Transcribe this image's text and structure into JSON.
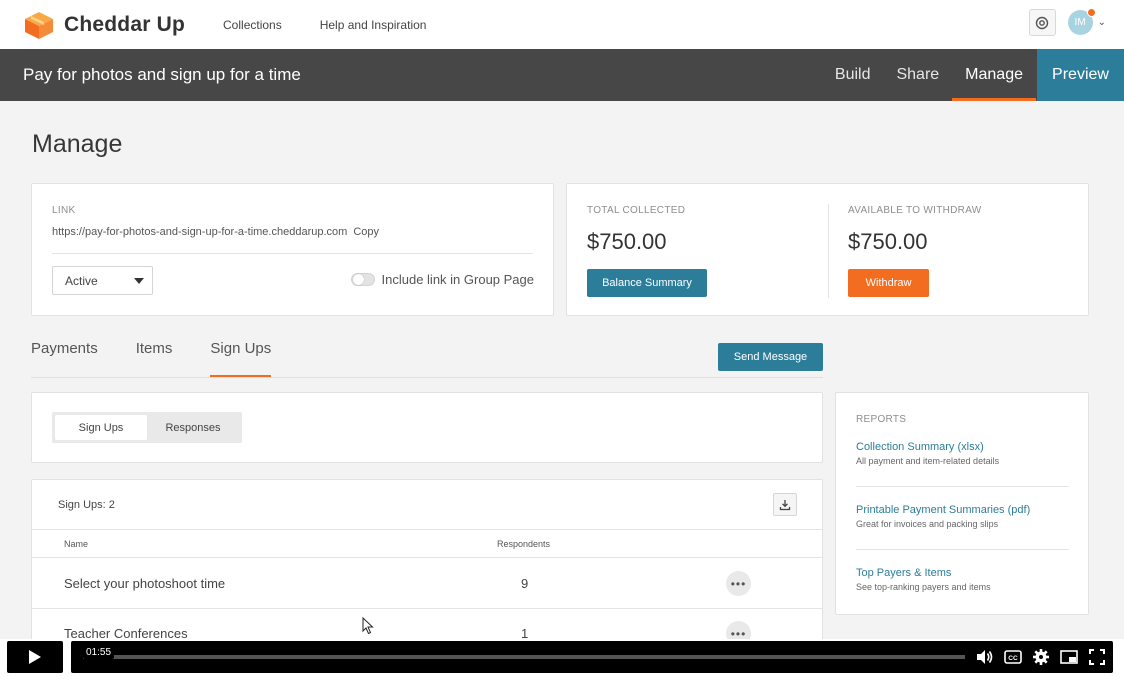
{
  "brand": {
    "name": "Cheddar Up",
    "accent": "#f36d21",
    "primary": "#2c7d99"
  },
  "topnav": {
    "links": [
      "Collections",
      "Help and Inspiration"
    ],
    "avatar_initials": "IM"
  },
  "header": {
    "title": "Pay for photos and sign up for a time",
    "tabs": [
      "Build",
      "Share",
      "Manage",
      "Preview"
    ],
    "active_tab": "Manage"
  },
  "page": {
    "title": "Manage"
  },
  "link_card": {
    "label": "LINK",
    "url": "https://pay-for-photos-and-sign-up-for-a-time.cheddarup.com",
    "copy_label": "Copy",
    "status_value": "Active",
    "toggle_label": "Include link in Group Page"
  },
  "money": {
    "total_label": "TOTAL COLLECTED",
    "total_amount": "$750.00",
    "balance_button": "Balance Summary",
    "available_label": "AVAILABLE TO WITHDRAW",
    "available_amount": "$750.00",
    "withdraw_button": "Withdraw"
  },
  "tabs": {
    "items": [
      "Payments",
      "Items",
      "Sign Ups"
    ],
    "active": "Sign Ups",
    "send_message": "Send Message"
  },
  "segments": {
    "items": [
      "Sign Ups",
      "Responses"
    ],
    "active": "Sign Ups"
  },
  "signups_table": {
    "count_label": "Sign Ups: 2",
    "columns": [
      "Name",
      "Respondents"
    ],
    "rows": [
      {
        "name": "Select your photoshoot time",
        "respondents": "9"
      },
      {
        "name": "Teacher Conferences",
        "respondents": "1"
      }
    ]
  },
  "reports": {
    "label": "REPORTS",
    "items": [
      {
        "title": "Collection Summary (xlsx)",
        "subtitle": "All payment and item-related details"
      },
      {
        "title": "Printable Payment Summaries (pdf)",
        "subtitle": "Great for invoices and packing slips"
      },
      {
        "title": "Top Payers & Items",
        "subtitle": "See top-ranking payers and items"
      }
    ]
  },
  "video": {
    "time": "01:55",
    "progress": 0.0
  }
}
